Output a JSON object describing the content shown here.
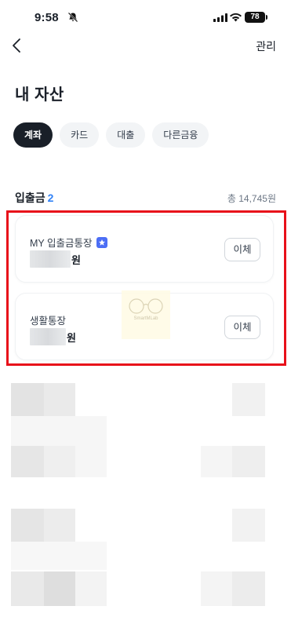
{
  "status_bar": {
    "time": "9:58",
    "battery": "78"
  },
  "nav": {
    "manage_label": "관리"
  },
  "page": {
    "title": "내 자산"
  },
  "tabs": [
    {
      "label": "계좌",
      "active": true
    },
    {
      "label": "카드",
      "active": false
    },
    {
      "label": "대출",
      "active": false
    },
    {
      "label": "다른금융",
      "active": false
    }
  ],
  "section": {
    "title": "입출금",
    "count": "2",
    "total": "총 14,745원"
  },
  "accounts": [
    {
      "name": "MY 입출금통장",
      "amount_suffix": "원",
      "transfer_label": "이체",
      "badge": "star-badge-icon"
    },
    {
      "name": "생활통장",
      "amount_suffix": "원",
      "transfer_label": "이체"
    }
  ],
  "watermark": {
    "text": "SmartMLab"
  },
  "colors": {
    "accent": "#3182f6",
    "highlight": "#e8101a",
    "active_tab": "#191f28"
  }
}
